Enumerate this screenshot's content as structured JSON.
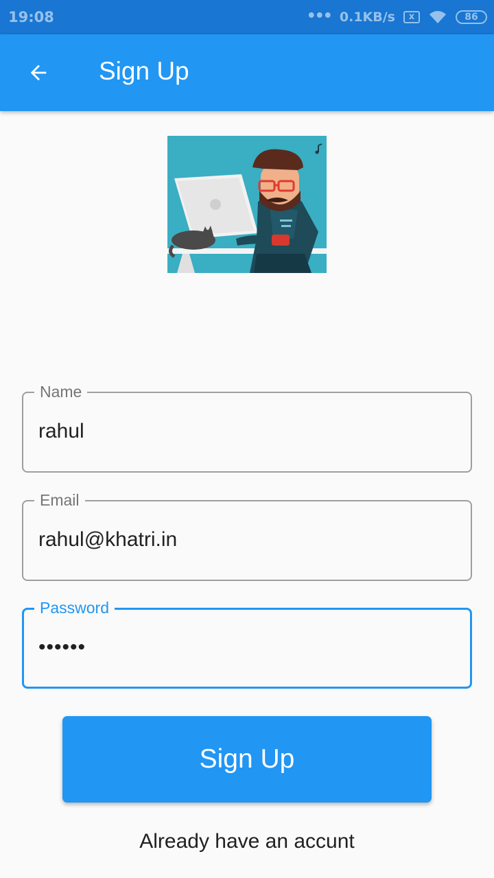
{
  "status_bar": {
    "time": "19:08",
    "dots": "•••",
    "speed": "0.1KB/s",
    "sim_icon": "x",
    "battery": "86"
  },
  "app_bar": {
    "back_icon": "arrow-back-icon",
    "title": "Sign Up",
    "color": "#2196f3"
  },
  "illustration": {
    "icon": "developer-at-computer-illustration"
  },
  "form": {
    "name": {
      "label": "Name",
      "value": "rahul"
    },
    "email": {
      "label": "Email",
      "value": "rahul@khatri.in"
    },
    "password": {
      "label": "Password",
      "value": "••••••",
      "focused": true
    }
  },
  "signup_button": {
    "label": "Sign Up"
  },
  "login_link": {
    "label": "Already have an accunt"
  },
  "colors": {
    "primary": "#2196f3",
    "status_bar": "#1976d2",
    "border": "#9e9e9e"
  }
}
